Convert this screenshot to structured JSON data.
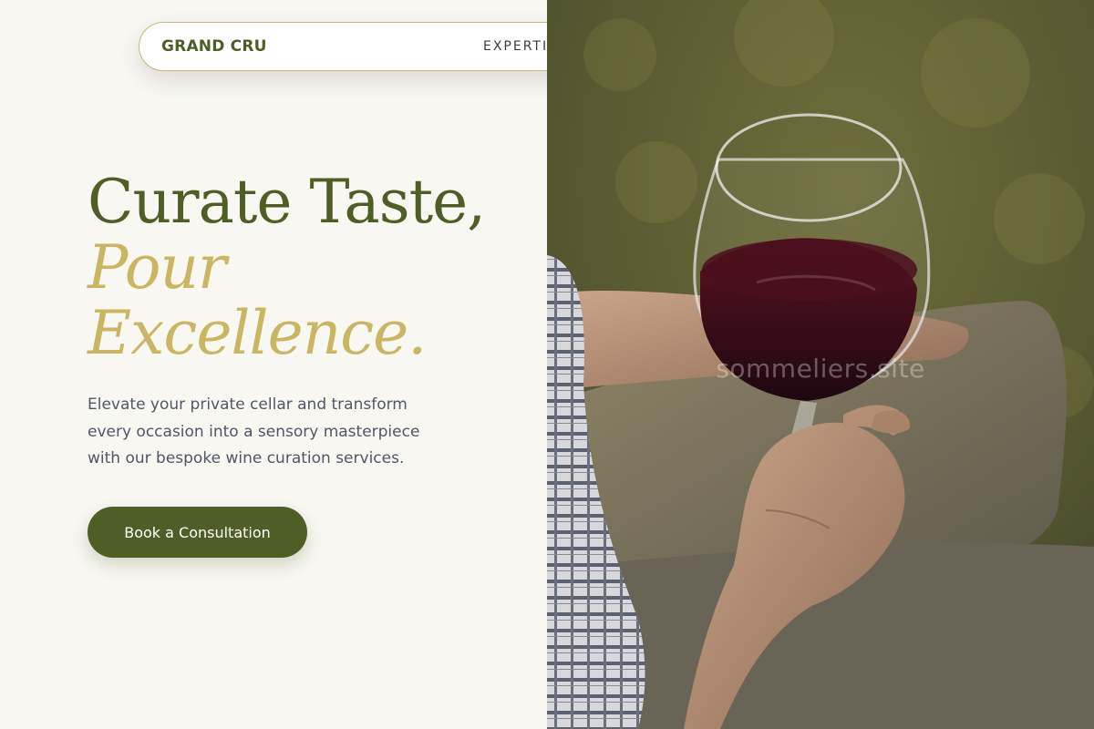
{
  "nav": {
    "brand": "GRAND CRU",
    "links": [
      "EXPERTISE"
    ]
  },
  "hero": {
    "title_line1": "Curate Taste,",
    "title_line2": "Pour",
    "title_line3": "Excellence.",
    "description": "Elevate your private cellar and transform every occasion into a sensory masterpiece with our bespoke wine curation services.",
    "cta_label": "Book a Consultation"
  },
  "photo": {
    "watermark": "sommeliers.site"
  },
  "colors": {
    "primary": "#4e5e26",
    "accent": "#c9b663",
    "background": "#f8f7f2",
    "body_text": "#4f5866"
  }
}
